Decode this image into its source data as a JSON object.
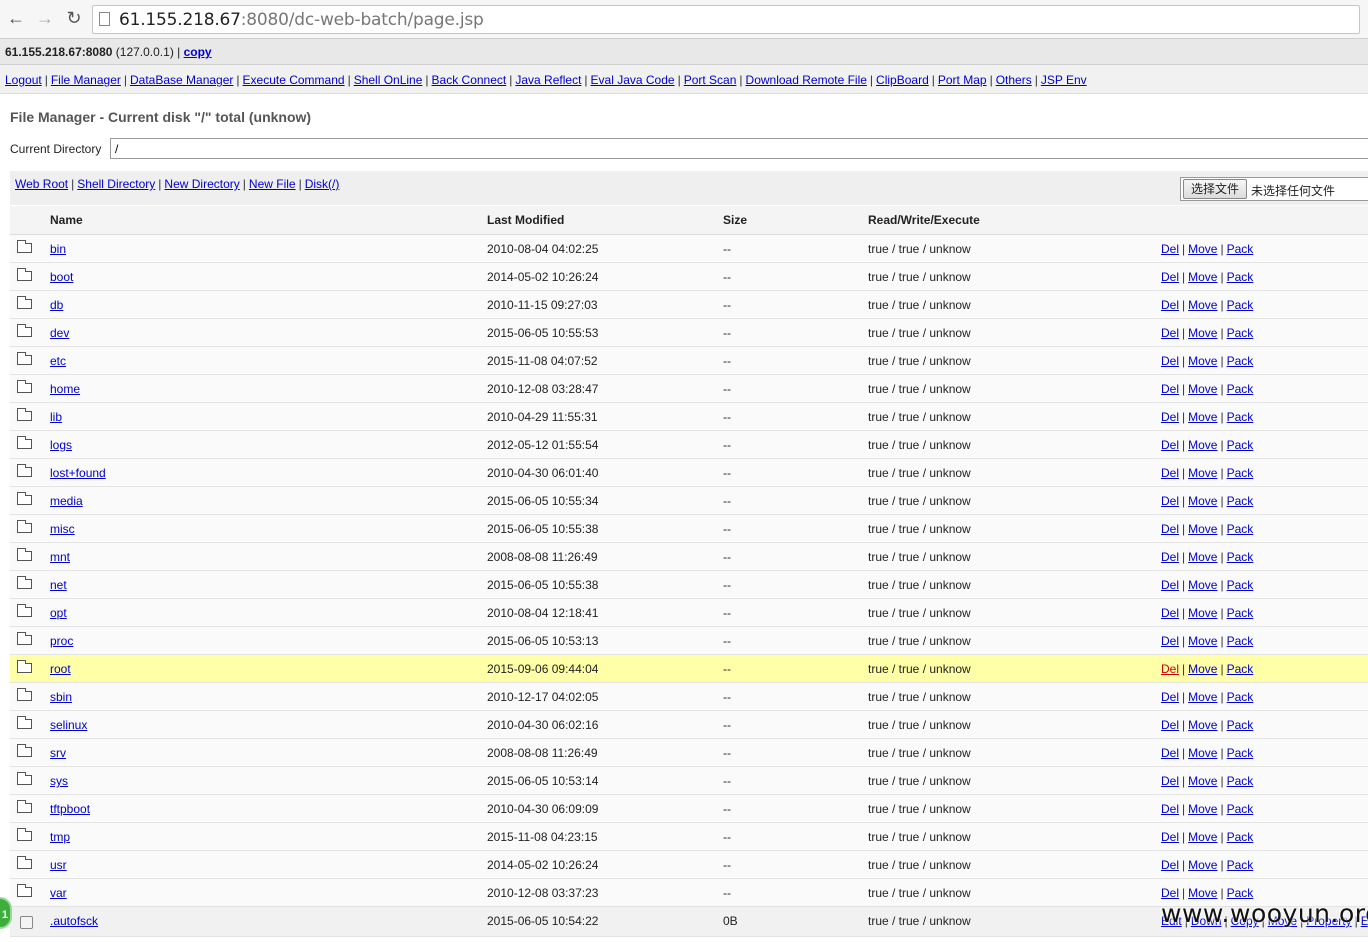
{
  "browser": {
    "url_host": "61.155.218.67",
    "url_rest": ":8080/dc-web-batch/page.jsp",
    "back_icon": "arrow-left",
    "forward_icon": "arrow-right",
    "reload_icon": "reload"
  },
  "hostbar": {
    "host": "61.155.218.67:8080",
    "local": " (127.0.0.1) | ",
    "copy": "copy"
  },
  "menu": [
    "Logout",
    "File Manager",
    "DataBase Manager",
    "Execute Command",
    "Shell OnLine",
    "Back Connect",
    "Java Reflect",
    "Eval Java Code",
    "Port Scan",
    "Download Remote File",
    "ClipBoard",
    "Port Map",
    "Others",
    "JSP Env"
  ],
  "title": "File Manager - Current disk \"/\" total (unknow)",
  "current_dir": {
    "label": "Current Directory",
    "value": "/"
  },
  "toolbar": {
    "links": [
      "Web Root",
      "Shell Directory",
      "New Directory",
      "New File",
      "Disk(/)"
    ],
    "file_button": "选择文件",
    "file_status": "未选择任何文件"
  },
  "table": {
    "headers": {
      "name": "Name",
      "modified": "Last Modified",
      "size": "Size",
      "rwe": "Read/Write/Execute"
    },
    "dir_actions": [
      "Del",
      "Move",
      "Pack"
    ],
    "file_actions": [
      "Edit",
      "Down",
      "Copy",
      "Move",
      "Property",
      "E"
    ],
    "rows": [
      {
        "name": "bin",
        "modified": "2010-08-04 04:02:25",
        "size": "--",
        "rwe": "true / true / unknow"
      },
      {
        "name": "boot",
        "modified": "2014-05-02 10:26:24",
        "size": "--",
        "rwe": "true / true / unknow"
      },
      {
        "name": "db",
        "modified": "2010-11-15 09:27:03",
        "size": "--",
        "rwe": "true / true / unknow"
      },
      {
        "name": "dev",
        "modified": "2015-06-05 10:55:53",
        "size": "--",
        "rwe": "true / true / unknow"
      },
      {
        "name": "etc",
        "modified": "2015-11-08 04:07:52",
        "size": "--",
        "rwe": "true / true / unknow"
      },
      {
        "name": "home",
        "modified": "2010-12-08 03:28:47",
        "size": "--",
        "rwe": "true / true / unknow"
      },
      {
        "name": "lib",
        "modified": "2010-04-29 11:55:31",
        "size": "--",
        "rwe": "true / true / unknow"
      },
      {
        "name": "logs",
        "modified": "2012-05-12 01:55:54",
        "size": "--",
        "rwe": "true / true / unknow"
      },
      {
        "name": "lost+found",
        "modified": "2010-04-30 06:01:40",
        "size": "--",
        "rwe": "true / true / unknow"
      },
      {
        "name": "media",
        "modified": "2015-06-05 10:55:34",
        "size": "--",
        "rwe": "true / true / unknow"
      },
      {
        "name": "misc",
        "modified": "2015-06-05 10:55:38",
        "size": "--",
        "rwe": "true / true / unknow"
      },
      {
        "name": "mnt",
        "modified": "2008-08-08 11:26:49",
        "size": "--",
        "rwe": "true / true / unknow"
      },
      {
        "name": "net",
        "modified": "2015-06-05 10:55:38",
        "size": "--",
        "rwe": "true / true / unknow"
      },
      {
        "name": "opt",
        "modified": "2010-08-04 12:18:41",
        "size": "--",
        "rwe": "true / true / unknow"
      },
      {
        "name": "proc",
        "modified": "2015-06-05 10:53:13",
        "size": "--",
        "rwe": "true / true / unknow"
      },
      {
        "name": "root",
        "modified": "2015-09-06 09:44:04",
        "size": "--",
        "rwe": "true / true / unknow",
        "highlight": true
      },
      {
        "name": "sbin",
        "modified": "2010-12-17 04:02:05",
        "size": "--",
        "rwe": "true / true / unknow"
      },
      {
        "name": "selinux",
        "modified": "2010-04-30 06:02:16",
        "size": "--",
        "rwe": "true / true / unknow"
      },
      {
        "name": "srv",
        "modified": "2008-08-08 11:26:49",
        "size": "--",
        "rwe": "true / true / unknow"
      },
      {
        "name": "sys",
        "modified": "2015-06-05 10:53:14",
        "size": "--",
        "rwe": "true / true / unknow"
      },
      {
        "name": "tftpboot",
        "modified": "2010-04-30 06:09:09",
        "size": "--",
        "rwe": "true / true / unknow"
      },
      {
        "name": "tmp",
        "modified": "2015-11-08 04:23:15",
        "size": "--",
        "rwe": "true / true / unknow"
      },
      {
        "name": "usr",
        "modified": "2014-05-02 10:26:24",
        "size": "--",
        "rwe": "true / true / unknow"
      },
      {
        "name": "var",
        "modified": "2010-12-08 03:37:23",
        "size": "--",
        "rwe": "true / true / unknow"
      },
      {
        "name": ".autofsck",
        "modified": "2015-06-05 10:54:22",
        "size": "0B",
        "rwe": "true / true / unknow",
        "is_file": true
      }
    ]
  },
  "colors": {
    "link": "#0000cc",
    "highlight_row": "#ffffa8",
    "del_active": "#cc0000"
  },
  "overlay": {
    "watermark": "www.wooyun.org",
    "badge": "1"
  }
}
